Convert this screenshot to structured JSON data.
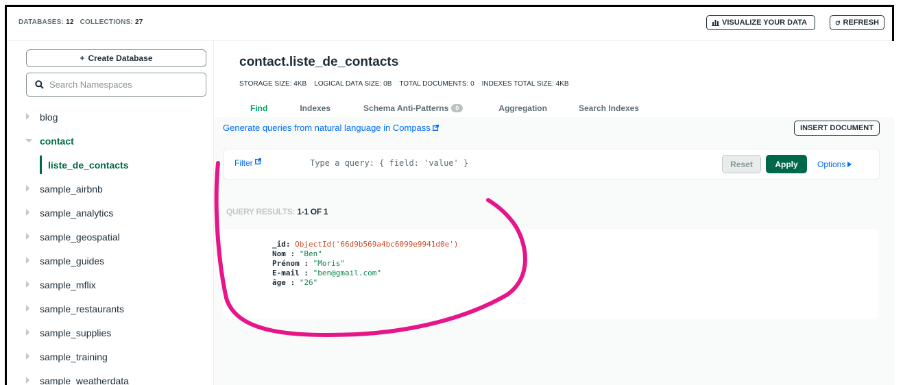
{
  "topbar": {
    "databases_label": "DATABASES:",
    "databases_count": "12",
    "collections_label": "COLLECTIONS:",
    "collections_count": "27",
    "visualize_label": "VISUALIZE YOUR DATA",
    "refresh_label": "REFRESH"
  },
  "sidebar": {
    "create_database_label": "Create Database",
    "search_placeholder": "Search Namespaces",
    "databases": [
      {
        "label": "blog"
      },
      {
        "label": "contact"
      },
      {
        "label": "liste_de_contacts"
      },
      {
        "label": "sample_airbnb"
      },
      {
        "label": "sample_analytics"
      },
      {
        "label": "sample_geospatial"
      },
      {
        "label": "sample_guides"
      },
      {
        "label": "sample_mflix"
      },
      {
        "label": "sample_restaurants"
      },
      {
        "label": "sample_supplies"
      },
      {
        "label": "sample_training"
      },
      {
        "label": "sample_weatherdata"
      }
    ]
  },
  "collection": {
    "title": "contact.liste_de_contacts",
    "stats": {
      "storage": "STORAGE SIZE: 4KB",
      "logical": "LOGICAL DATA SIZE: 0B",
      "total_docs": "TOTAL DOCUMENTS: 0",
      "indexes_size": "INDEXES TOTAL SIZE: 4KB"
    },
    "tabs": {
      "find": "Find",
      "indexes": "Indexes",
      "schema": "Schema Anti-Patterns",
      "schema_badge": "0",
      "aggregation": "Aggregation",
      "search_indexes": "Search Indexes"
    }
  },
  "query": {
    "nl_link": "Generate queries from natural language in Compass",
    "insert_document": "INSERT DOCUMENT",
    "filter_label": "Filter",
    "filter_placeholder": "Type a query: { field: 'value' }",
    "reset": "Reset",
    "apply": "Apply",
    "options": "Options"
  },
  "results": {
    "label": "QUERY RESULTS:",
    "range": "1-1 OF 1",
    "document": {
      "id_key": "_id:",
      "id_value": "ObjectId('66d9b569a4bc6099e9941d0e')",
      "nom_key": "Nom :",
      "nom_value": "\"Ben\"",
      "prenom_key": "Prénom :",
      "prenom_value": "\"Moris\"",
      "email_key": "E-mail :",
      "email_value": "\"ben@gmail.com\"",
      "age_key": "âge :",
      "age_value": "\"26\""
    }
  },
  "colors": {
    "accent_green": "#00684a",
    "link_blue": "#016bf8",
    "annotation_pink": "#e6158a"
  }
}
